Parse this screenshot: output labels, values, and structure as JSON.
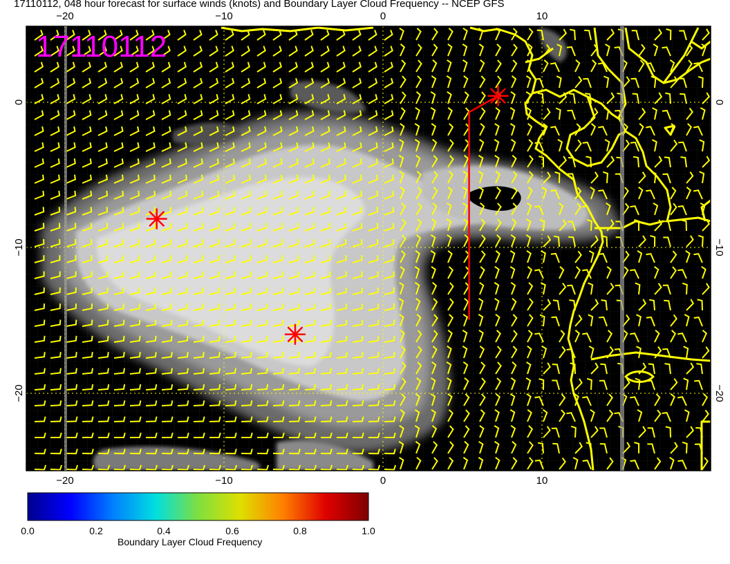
{
  "title": "17110112, 048 hour forecast for surface winds (knots) and Boundary Layer Cloud Frequency -- NCEP GFS",
  "date_stamp": "17110112",
  "map": {
    "lon_tick_labels": [
      "−20",
      "−10",
      "0",
      "10"
    ],
    "lat_tick_labels": [
      "0",
      "−10",
      "−20"
    ],
    "lon_range": [
      -22.5,
      20
    ],
    "lat_range": [
      -25,
      5
    ],
    "barb_color": "#ffff00",
    "coast_color": "#ffff00",
    "marker_color": "#ff0000",
    "grid_color": "#ffff00"
  },
  "markers": [
    {
      "lon": 6.8,
      "lat": 0.3
    },
    {
      "lon": -14.4,
      "lat": -8.0
    },
    {
      "lon": -5.8,
      "lat": -15.8
    }
  ],
  "track": {
    "lon": 5.0,
    "lat_top": -0.8,
    "lat_bottom": -14.8
  },
  "colorbar": {
    "label": "Boundary Layer Cloud Frequency",
    "ticks": [
      "0.0",
      "0.2",
      "0.4",
      "0.6",
      "0.8",
      "1.0"
    ],
    "colors": [
      "#00008f",
      "#0000ff",
      "#007fff",
      "#00dfdf",
      "#7fdf3f",
      "#dfdf00",
      "#ff7f00",
      "#df0000",
      "#7f0000"
    ]
  }
}
